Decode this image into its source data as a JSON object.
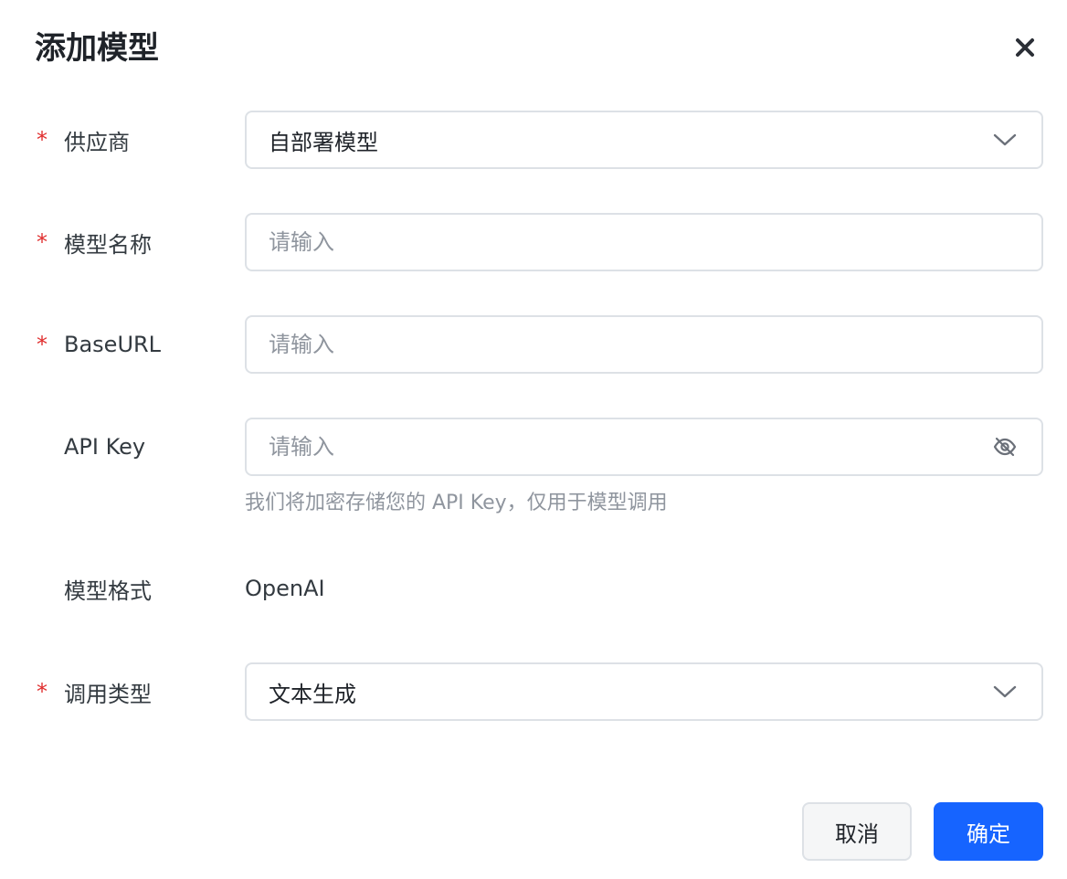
{
  "dialog": {
    "title": "添加模型",
    "close_icon": "close-icon"
  },
  "form": {
    "provider": {
      "label": "供应商",
      "required": true,
      "value": "自部署模型"
    },
    "model_name": {
      "label": "模型名称",
      "required": true,
      "placeholder": "请输入"
    },
    "base_url": {
      "label": "BaseURL",
      "required": true,
      "placeholder": "请输入"
    },
    "api_key": {
      "label": "API Key",
      "required": false,
      "placeholder": "请输入",
      "help": "我们将加密存储您的 API Key，仅用于模型调用",
      "icon": "eye-off-icon"
    },
    "model_format": {
      "label": "模型格式",
      "value": "OpenAI"
    },
    "call_type": {
      "label": "调用类型",
      "required": true,
      "value": "文本生成"
    }
  },
  "footer": {
    "cancel_label": "取消",
    "ok_label": "确定"
  },
  "colors": {
    "primary": "#1664ff",
    "required": "#e02d2d",
    "border": "#dde1e6",
    "placeholder": "#8f959e"
  }
}
